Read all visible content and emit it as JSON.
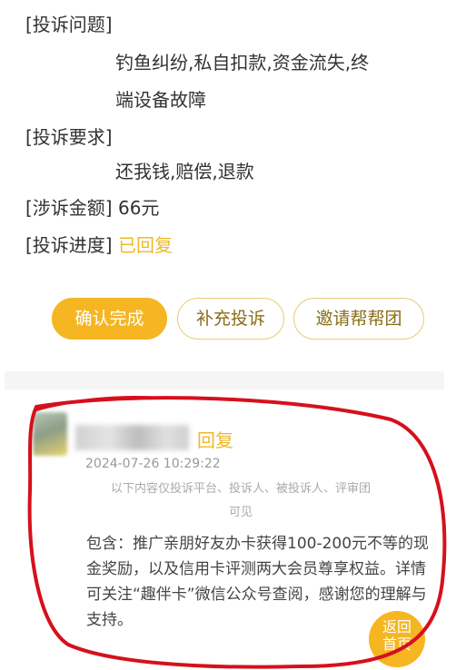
{
  "complaint": {
    "issue_label": "[投诉问题]",
    "issue_line1": "钓鱼纠纷,私自扣款,资金流失,终",
    "issue_line2": "端设备故障",
    "request_label": "[投诉要求]",
    "request_value": "还我钱,赔偿,退款",
    "amount_label": "[涉诉金额]",
    "amount_value": "66元",
    "progress_label": "[投诉进度]",
    "progress_value": "已回复"
  },
  "actions": {
    "confirm": "确认完成",
    "supplement": "补充投诉",
    "invite": "邀请帮帮团"
  },
  "reply": {
    "label": "回复",
    "timestamp": "2024-07-26 10:29:22",
    "visibility_line1": "以下内容仅投诉平台、投诉人、被投诉人、评审团",
    "visibility_line2": "可见",
    "content": "包含：推广亲朋好友办卡获得100-200元不等的现金奖励，以及信用卡评测两大会员尊享权益。详情可关注“趣伴卡”微信公众号查阅，感谢您的理解与支持。"
  },
  "back_button": {
    "line1": "返回",
    "line2": "首页"
  },
  "colors": {
    "accent": "#f5b622",
    "annotation": "#d6101c"
  }
}
